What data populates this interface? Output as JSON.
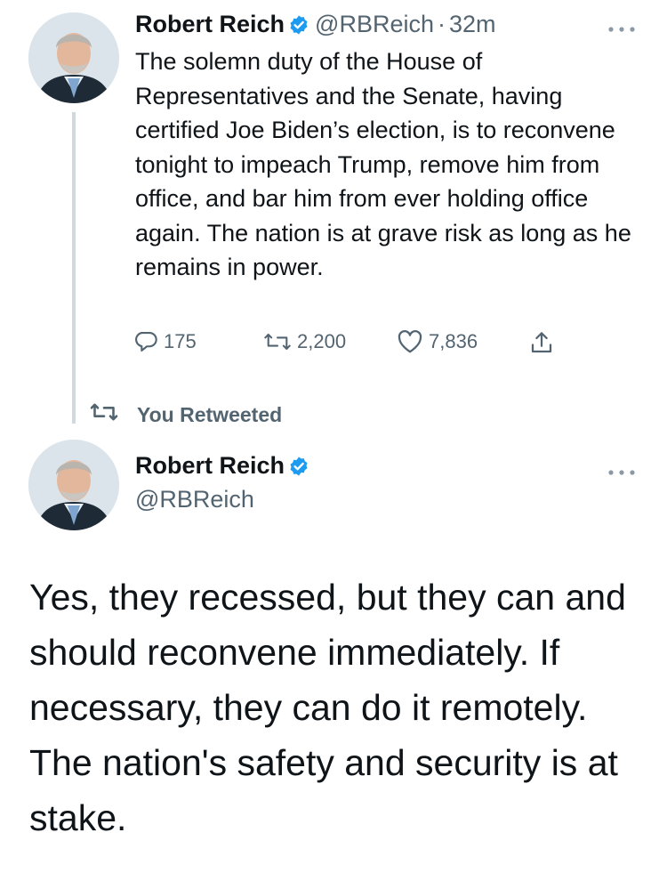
{
  "tweet_top": {
    "author_name": "Robert Reich",
    "handle": "@RBReich",
    "separator": "·",
    "time": "32m",
    "text": "The solemn duty of the House of Representatives and the Senate, having certified Joe Biden’s election, is to reconvene tonight to impeach Trump, remove him from office, and bar him from ever holding office again. The nation is at grave risk as long as he remains in power.",
    "replies": "175",
    "retweets": "2,200",
    "likes": "7,836"
  },
  "retweet_context": {
    "label": "You Retweeted"
  },
  "tweet_main": {
    "author_name": "Robert Reich",
    "handle": "@RBReich",
    "text": "Yes, they recessed, but they can and should reconvene immediately. If necessary, they can do it remotely. The nation's safety and security is at stake."
  },
  "icons": {
    "verified": "verified-badge-icon",
    "more": "more-options-icon",
    "reply": "reply-icon",
    "retweet": "retweet-icon",
    "like": "like-icon",
    "share": "share-icon"
  },
  "colors": {
    "verified_blue": "#1d9bf0",
    "text_primary": "#0f1419",
    "text_secondary": "#536471",
    "thread_line": "#cfd9de"
  }
}
